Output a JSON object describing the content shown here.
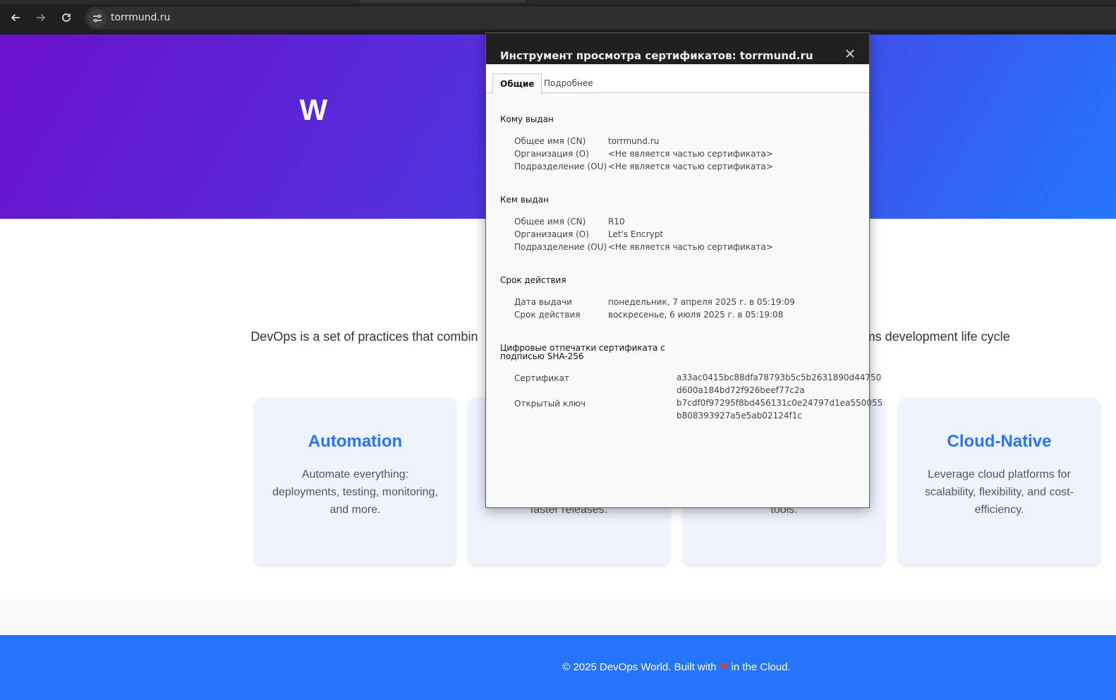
{
  "browser": {
    "url": "torrmund.ru",
    "back_icon": "arrow-left-icon",
    "forward_icon": "arrow-right-icon",
    "reload_icon": "reload-icon",
    "site_info_icon": "tune-icon"
  },
  "page": {
    "hero_title": "W                                                        d!",
    "intro": "DevOps is a set of practices that combin                                                                                      orten the systems development life cycle",
    "cards": [
      {
        "title": "Automation",
        "text": "Automate everything: deployments, testing, monitoring, and more."
      },
      {
        "title": "",
        "text": "faster releases."
      },
      {
        "title": "",
        "text": "tools."
      },
      {
        "title": "Cloud-Native",
        "text": "Leverage cloud platforms for scalability, flexibility, and cost-efficiency."
      }
    ],
    "footer_prefix": "© 2025 DevOps World. Built with",
    "footer_heart": "❤",
    "footer_suffix": "in the Cloud."
  },
  "cert": {
    "title": "Инструмент просмотра сертификатов: torrmund.ru",
    "close_icon": "close-icon",
    "tabs": [
      "Общие",
      "Подробнее"
    ],
    "issued_to": {
      "heading": "Кому выдан",
      "rows": [
        {
          "label": "Общее имя (CN)",
          "value": "torrmund.ru"
        },
        {
          "label": "Организация (O)",
          "value": "<Не является частью сертификата>"
        },
        {
          "label": "Подразделение (OU)",
          "value": "<Не является частью сертификата>"
        }
      ]
    },
    "issued_by": {
      "heading": "Кем выдан",
      "rows": [
        {
          "label": "Общее имя (CN)",
          "value": "R10"
        },
        {
          "label": "Организация (O)",
          "value": "Let's Encrypt"
        },
        {
          "label": "Подразделение (OU)",
          "value": "<Не является частью сертификата>"
        }
      ]
    },
    "validity": {
      "heading": "Срок действия",
      "rows": [
        {
          "label": "Дата выдачи",
          "value": "понедельник, 7 апреля 2025 г. в 05:19:09"
        },
        {
          "label": "Срок действия",
          "value": "воскресенье, 6 июля 2025 г. в 05:19:08"
        }
      ]
    },
    "fingerprints": {
      "heading": "Цифровые отпечатки сертификата с подписью SHA-256",
      "rows": [
        {
          "label": "Сертификат",
          "value_line1": "a33ac0415bc88dfa78793b5c5b2631890d44750",
          "value_line2": "d600a184bd72f926beef77c2a"
        },
        {
          "label": "Открытый ключ",
          "value_line1": "b7cdf0f97295f8bd456131c0e24797d1ea550055",
          "value_line2": "b808393927a5e5ab02124f1c"
        }
      ]
    }
  }
}
